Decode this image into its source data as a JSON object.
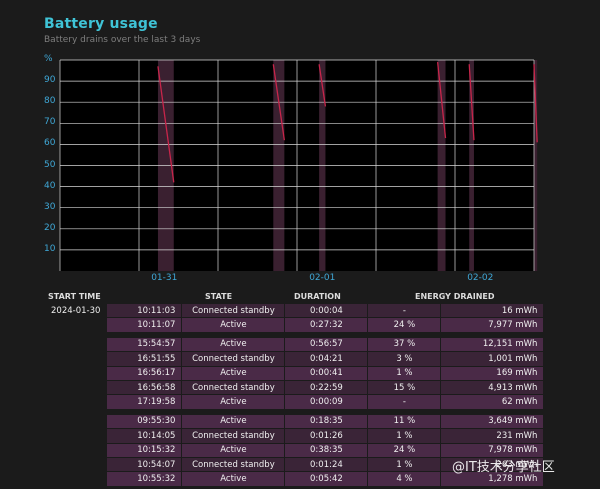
{
  "header": {
    "title": "Battery usage",
    "subtitle": "Battery drains over the last 3 days"
  },
  "chart_data": {
    "type": "line",
    "ylabel": "%",
    "ylim": [
      0,
      100
    ],
    "y_ticks": [
      "90",
      "80",
      "70",
      "60",
      "50",
      "40",
      "30",
      "20",
      "10"
    ],
    "x_ticks": [
      "01-31",
      "02-01",
      "02-02"
    ],
    "grid": true,
    "series": [
      {
        "values": [
          [
            0.62,
            97
          ],
          [
            0.72,
            42
          ]
        ]
      },
      {
        "values": [
          [
            1.35,
            98
          ],
          [
            1.42,
            62
          ]
        ]
      },
      {
        "values": [
          [
            1.64,
            98
          ],
          [
            1.68,
            78
          ]
        ]
      },
      {
        "values": [
          [
            2.39,
            99
          ],
          [
            2.44,
            63
          ]
        ]
      },
      {
        "values": [
          [
            2.59,
            98
          ],
          [
            2.62,
            62
          ]
        ]
      },
      {
        "values": [
          [
            3.0,
            98
          ],
          [
            3.02,
            61
          ]
        ]
      }
    ],
    "bars": [
      {
        "x0": 0.62,
        "x1": 0.72
      },
      {
        "x0": 1.35,
        "x1": 1.42
      },
      {
        "x0": 1.64,
        "x1": 1.68
      },
      {
        "x0": 2.39,
        "x1": 2.44
      },
      {
        "x0": 2.59,
        "x1": 2.62
      },
      {
        "x0": 3.0,
        "x1": 3.02
      }
    ],
    "colors": {
      "line": "#c8254a",
      "bar": "#3a2030",
      "grid": "#d8d8d8",
      "axis_text": "#3fa7d6"
    }
  },
  "table": {
    "headers": [
      "START TIME",
      "STATE",
      "DURATION",
      "ENERGY DRAINED"
    ],
    "rows": [
      {
        "date": "2024-01-30",
        "time": "10:11:03",
        "state": "Connected standby",
        "duration": "0:00:04",
        "pct": "-",
        "energy": "16 mWh"
      },
      {
        "date": "",
        "time": "10:11:07",
        "state": "Active",
        "duration": "0:27:32",
        "pct": "24 %",
        "energy": "7,977 mWh"
      },
      {
        "gap": true
      },
      {
        "date": "",
        "time": "15:54:57",
        "state": "Active",
        "duration": "0:56:57",
        "pct": "37 %",
        "energy": "12,151 mWh"
      },
      {
        "date": "",
        "time": "16:51:55",
        "state": "Connected standby",
        "duration": "0:04:21",
        "pct": "3 %",
        "energy": "1,001 mWh"
      },
      {
        "date": "",
        "time": "16:56:17",
        "state": "Active",
        "duration": "0:00:41",
        "pct": "1 %",
        "energy": "169 mWh"
      },
      {
        "date": "",
        "time": "16:56:58",
        "state": "Connected standby",
        "duration": "0:22:59",
        "pct": "15 %",
        "energy": "4,913 mWh"
      },
      {
        "date": "",
        "time": "17:19:58",
        "state": "Active",
        "duration": "0:00:09",
        "pct": "-",
        "energy": "62 mWh"
      },
      {
        "gap": true
      },
      {
        "date": "",
        "time": "09:55:30",
        "state": "Active",
        "duration": "0:18:35",
        "pct": "11 %",
        "energy": "3,649 mWh"
      },
      {
        "date": "",
        "time": "10:14:05",
        "state": "Connected standby",
        "duration": "0:01:26",
        "pct": "1 %",
        "energy": "231 mWh"
      },
      {
        "date": "",
        "time": "10:15:32",
        "state": "Active",
        "duration": "0:38:35",
        "pct": "24 %",
        "energy": "7,978 mWh"
      },
      {
        "date": "",
        "time": "10:54:07",
        "state": "Connected standby",
        "duration": "0:01:24",
        "pct": "1 %",
        "energy": "263 mWh"
      },
      {
        "date": "",
        "time": "10:55:32",
        "state": "Active",
        "duration": "0:05:42",
        "pct": "4 %",
        "energy": "1,278 mWh"
      }
    ]
  },
  "watermark": "@IT技术分享社区"
}
